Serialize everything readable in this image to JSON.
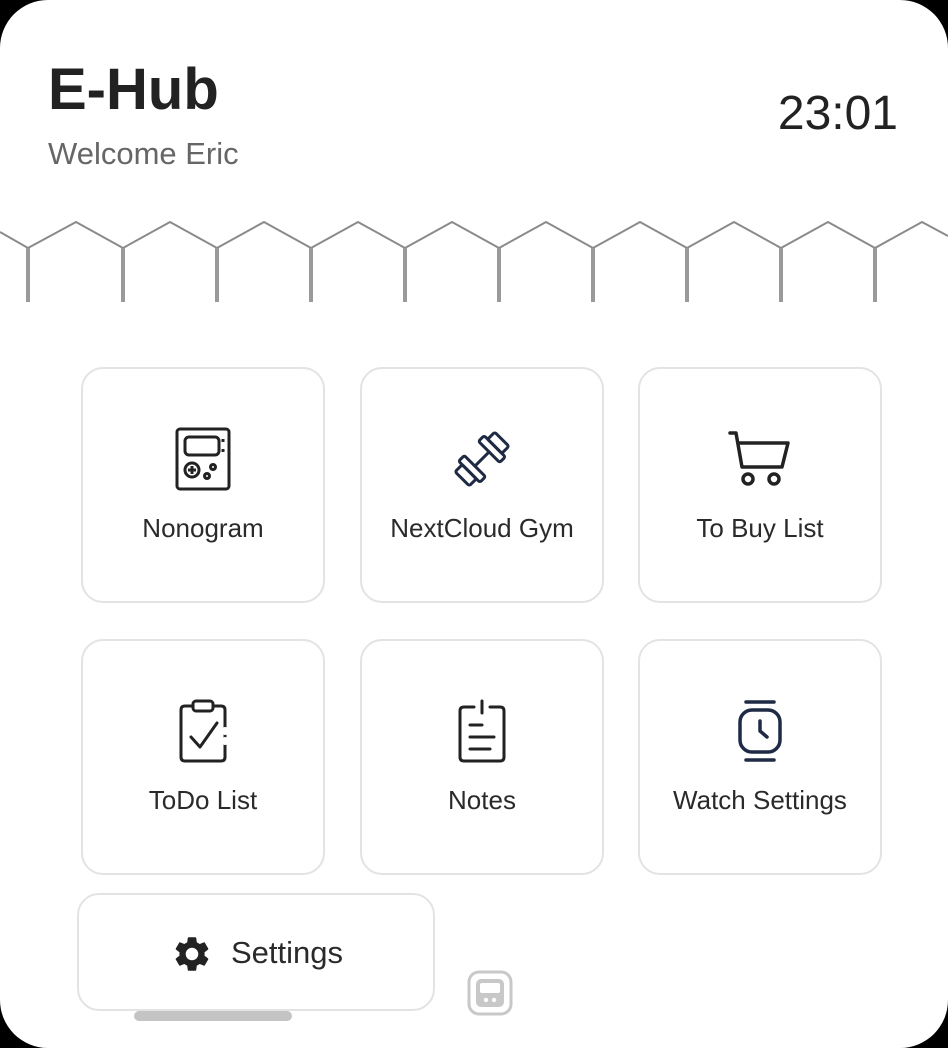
{
  "header": {
    "title": "E-Hub",
    "welcome": "Welcome Eric",
    "time": "23:01"
  },
  "apps": [
    {
      "label": "Nonogram",
      "icon": "handheld-game-icon"
    },
    {
      "label": "NextCloud Gym",
      "icon": "dumbbell-icon"
    },
    {
      "label": "To Buy List",
      "icon": "shopping-cart-icon"
    },
    {
      "label": "ToDo List",
      "icon": "clipboard-check-icon"
    },
    {
      "label": "Notes",
      "icon": "notes-icon"
    },
    {
      "label": "Watch Settings",
      "icon": "watch-icon"
    }
  ],
  "settings": {
    "label": "Settings",
    "icon": "gear-icon"
  },
  "colors": {
    "background": "#ffffff",
    "text": "#222222",
    "subtext": "#666666",
    "tile_border": "#e3e3e3",
    "accent_icon": "#1f2a44",
    "fence": "#8a8a8a"
  }
}
